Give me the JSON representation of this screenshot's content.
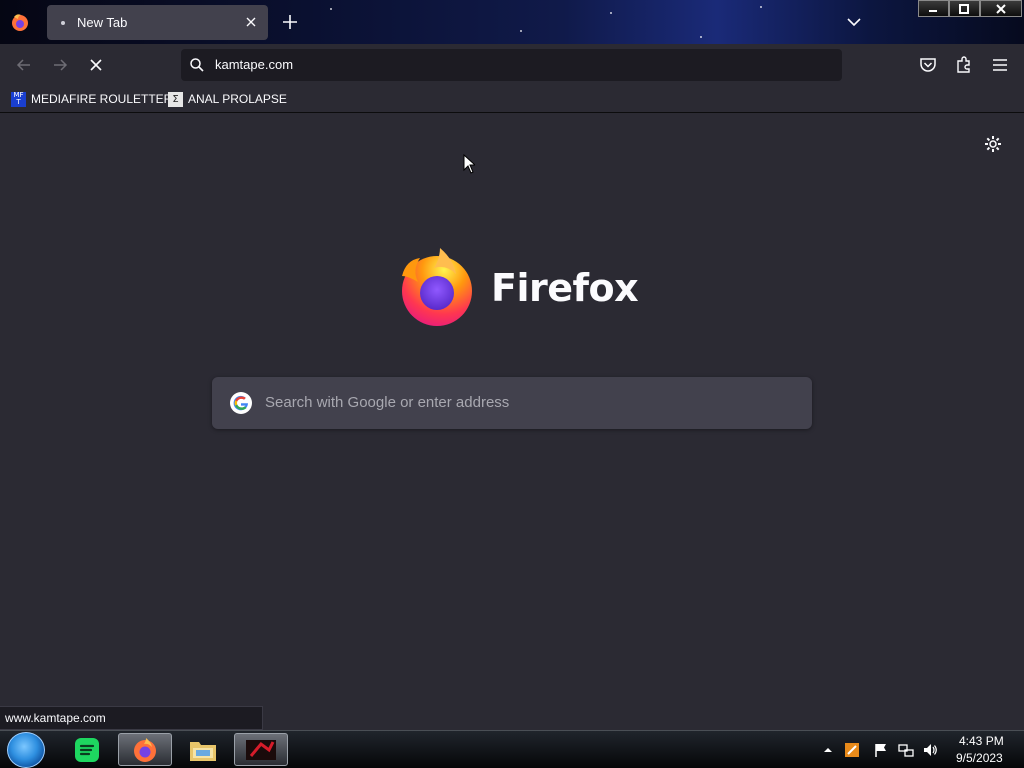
{
  "browser": {
    "tab": {
      "title": "New Tab"
    },
    "url": "kamtape.com",
    "bookmarks": [
      {
        "label": "MEDIAFIRE ROULETTER",
        "favicon_text": "MF T"
      },
      {
        "label": "ANAL PROLAPSE",
        "favicon_text": "Σ"
      }
    ]
  },
  "newtab": {
    "wordmark": "Firefox",
    "search_placeholder": "Search with Google or enter address"
  },
  "status_bar": {
    "text": "www.kamtape.com"
  },
  "taskbar": {
    "time": "4:43 PM",
    "date": "9/5/2023"
  },
  "icons": {
    "tab_close": "close-icon",
    "new_tab": "plus-icon",
    "back": "back-arrow-icon",
    "forward": "forward-arrow-icon",
    "stop": "stop-icon",
    "pocket": "pocket-icon",
    "extensions": "puzzle-icon",
    "menu": "hamburger-icon",
    "settings": "gear-icon"
  },
  "colors": {
    "accent_firefox": "#ff7139",
    "page_bg": "#2b2a33",
    "urlbar_bg": "#1c1b22",
    "search_bg": "#42414d"
  }
}
